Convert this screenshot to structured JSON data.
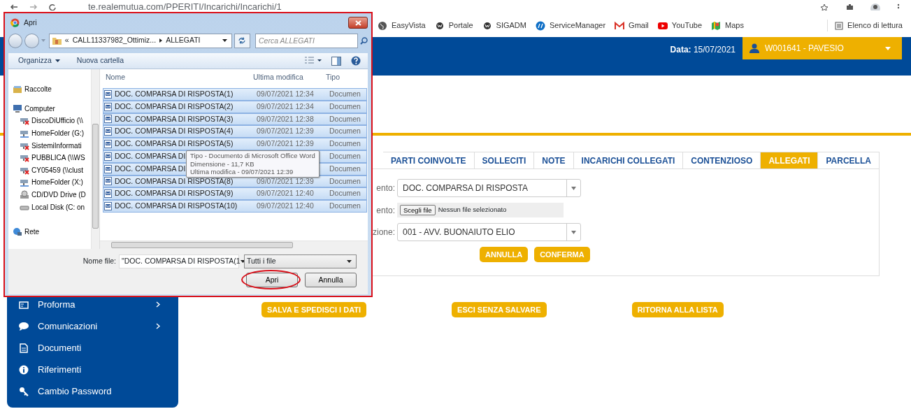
{
  "browser": {
    "url": "te.realemutua.com/PPERITI/Incarichi/Incarichi/1",
    "bookmarks": [
      {
        "label": "EasyVista",
        "kind": "globe"
      },
      {
        "label": "Portale",
        "kind": "w"
      },
      {
        "label": "SIGADM",
        "kind": "w"
      },
      {
        "label": "ServiceManager",
        "kind": "round"
      },
      {
        "label": "Gmail",
        "kind": "m"
      },
      {
        "label": "YouTube",
        "kind": "play"
      },
      {
        "label": "Maps",
        "kind": "map"
      }
    ],
    "reading_list": "Elenco di lettura"
  },
  "header": {
    "date_label": "Data:",
    "date": "15/07/2021",
    "user": "W001641 - PAVESIO"
  },
  "tabs": [
    {
      "label": "PARTI COINVOLTE",
      "selected": false
    },
    {
      "label": "SOLLECITI",
      "selected": false
    },
    {
      "label": "NOTE",
      "selected": false
    },
    {
      "label": "INCARICHI COLLEGATI",
      "selected": false
    },
    {
      "label": "CONTENZIOSO",
      "selected": false
    },
    {
      "label": "ALLEGATI",
      "selected": true
    },
    {
      "label": "PARCELLA",
      "selected": false
    }
  ],
  "form": {
    "rows": [
      {
        "label": "ento:",
        "kind": "select",
        "value": "DOC. COMPARSA DI RISPOSTA"
      },
      {
        "label": "ento:",
        "kind": "file",
        "button": "Scegli file",
        "status": "Nessun file selezionato"
      },
      {
        "label": "zione:",
        "kind": "select",
        "value": "001 - AVV. BUONAIUTO ELIO"
      }
    ],
    "buttons": [
      "ANNULLA",
      "CONFERMA"
    ]
  },
  "actions": [
    "SALVA E SPEDISCI I DATI",
    "ESCI SENZA SALVARE",
    "RITORNA ALLA LISTA"
  ],
  "sidebar": {
    "items": [
      {
        "label": "Proforma",
        "kind": "card",
        "submenu": true
      },
      {
        "label": "Comunicazioni",
        "kind": "chat",
        "submenu": true
      },
      {
        "label": "Documenti",
        "kind": "document",
        "submenu": false
      },
      {
        "label": "Riferimenti",
        "kind": "info",
        "submenu": false
      },
      {
        "label": "Cambio Password",
        "kind": "key",
        "submenu": false
      }
    ]
  },
  "dialog": {
    "title": "Apri",
    "overflow": "«",
    "path": [
      "CALL11337982_Ottimiz...",
      "ALLEGATI"
    ],
    "search_placeholder": "Cerca ALLEGATI",
    "toolbar": [
      {
        "label": "Organizza",
        "kind": "menu"
      },
      {
        "label": "Nuova cartella",
        "kind": "button"
      }
    ],
    "nav": [
      {
        "label": "Raccolte",
        "kind": "library"
      },
      {
        "label": "Computer",
        "kind": "computer",
        "children": [
          {
            "label": "DiscoDiUfficio (\\\\",
            "kind": "offline"
          },
          {
            "label": "HomeFolder (G:)",
            "kind": "netdrive"
          },
          {
            "label": "SistemiInformati",
            "kind": "offline"
          },
          {
            "label": "PUBBLICA (\\\\WS",
            "kind": "offline"
          },
          {
            "label": "CY05459 (\\\\clust",
            "kind": "offline"
          },
          {
            "label": "HomeFolder (X:)",
            "kind": "netdrive"
          },
          {
            "label": "CD/DVD Drive (D",
            "kind": "disc"
          },
          {
            "label": "Local Disk (C: on",
            "kind": "disk"
          }
        ]
      },
      {
        "label": "Rete",
        "kind": "network"
      }
    ],
    "columns": [
      "Nome",
      "Ultima modifica",
      "Tipo"
    ],
    "files": [
      {
        "name": "DOC. COMPARSA DI RISPOSTA(1)",
        "modified": "09/07/2021 12:34",
        "type": "Documen",
        "selected": true
      },
      {
        "name": "DOC. COMPARSA DI RISPOSTA(2)",
        "modified": "09/07/2021 12:34",
        "type": "Documen",
        "selected": true
      },
      {
        "name": "DOC. COMPARSA DI RISPOSTA(3)",
        "modified": "09/07/2021 12:38",
        "type": "Documen",
        "selected": true
      },
      {
        "name": "DOC. COMPARSA DI RISPOSTA(4)",
        "modified": "09/07/2021 12:39",
        "type": "Documen",
        "selected": true
      },
      {
        "name": "DOC. COMPARSA DI RISPOSTA(5)",
        "modified": "09/07/2021 12:39",
        "type": "Documen",
        "selected": true
      },
      {
        "name": "DOC. COMPARSA DI",
        "type": "Documen",
        "selected": true
      },
      {
        "name": "DOC. COMPARSA DI",
        "type": "Documen",
        "selected": true
      },
      {
        "name": "DOC. COMPARSA DI RISPOSTA(8)",
        "modified": "09/07/2021 12:39",
        "type": "Documen",
        "selected": true
      },
      {
        "name": "DOC. COMPARSA DI RISPOSTA(9)",
        "modified": "09/07/2021 12:40",
        "type": "Documen",
        "selected": true
      },
      {
        "name": "DOC. COMPARSA DI RISPOSTA(10)",
        "modified": "09/07/2021 12:40",
        "type": "Documen",
        "selected": true
      }
    ],
    "tooltip": [
      "Tipo - Documento di Microsoft Office Word",
      "Dimensione - 11,7 KB",
      "Ultima modifica - 09/07/2021 12:39"
    ],
    "filename_label": "Nome file:",
    "filename": "\"DOC. COMPARSA DI RISPOSTA(1",
    "filter": "Tutti i file",
    "buttons": [
      {
        "label": "Apri",
        "highlighted": true
      },
      {
        "label": "Annulla",
        "highlighted": false
      }
    ]
  }
}
